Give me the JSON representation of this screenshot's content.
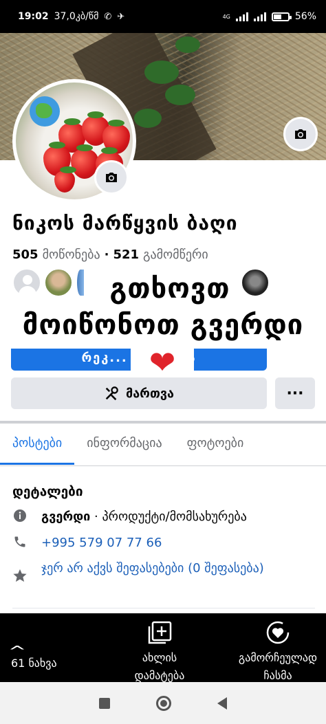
{
  "status_bar": {
    "time": "19:02",
    "speed": "37,0კბ/წმ",
    "network": "4G",
    "battery": "56%",
    "battery_level": 0.56
  },
  "page": {
    "name": "ნიკოს მარწყვის ბაღი",
    "likes_count": "505",
    "likes_label": "მოწონება",
    "separator": "·",
    "followers_count": "521",
    "followers_label": "გამომწერი"
  },
  "overlay": {
    "line1": "გთხოვთ",
    "line2": "მოიწონოთ გვერდი",
    "heart": "❤"
  },
  "buttons": {
    "primary_label": "რეკ... ...კვეთა",
    "secondary_label": "მართვა",
    "more_label": "···"
  },
  "tabs": [
    {
      "label": "პოსტები",
      "active": true
    },
    {
      "label": "ინფორმაცია",
      "active": false
    },
    {
      "label": "ფოტოები",
      "active": false
    }
  ],
  "details": {
    "title": "დეტალები",
    "category_prefix": "გვერდი",
    "category_rest": " · პროდუქტი/მომსახურება",
    "phone": "+995 579 07 77 66",
    "rating": "ჯერ არ აქვს შეფასებები (0 შეფასება)"
  },
  "action_bar": {
    "likes": "61 ნახვა",
    "add_new": "ახლის დამატება",
    "hide": "გამორჩეულად ჩასმა"
  },
  "colors": {
    "accent": "#1b74e4",
    "secondary_bg": "#e4e6eb",
    "heart": "#e0242b"
  },
  "icons": [
    "camera-icon",
    "info-icon",
    "phone-icon",
    "star-icon",
    "tools-icon",
    "chevron-up-icon",
    "add-square-icon",
    "heart-circle-icon"
  ]
}
